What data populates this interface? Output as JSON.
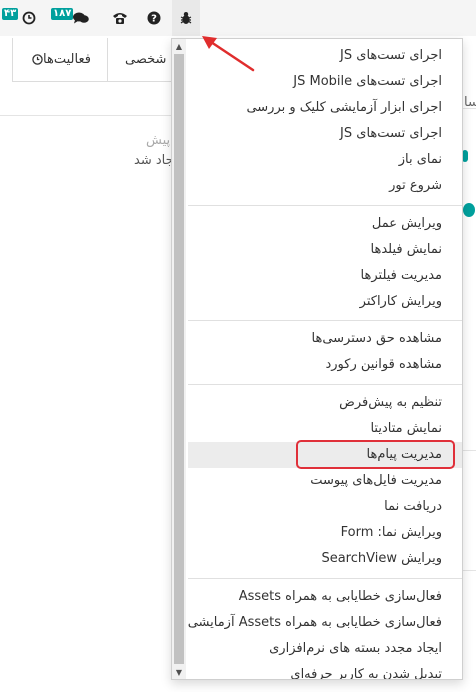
{
  "navbar": {
    "activity_badge": "۴۳",
    "messages_badge": "۱۸۷"
  },
  "tabs": {
    "activities_label": "فعالیت‌ها",
    "personal_label": "شخصی"
  },
  "background": {
    "line1": "ر پیش",
    "line2": "جاد شد",
    "frag1": "مسا"
  },
  "debug_menu": {
    "groups": [
      {
        "items": [
          "اجرای تست‌های JS",
          "اجرای تست‌های JS Mobile",
          "اجرای ابزار آزمایشی کلیک و بررسی",
          "اجرای تست‌های JS",
          "نمای باز",
          "شروع تور"
        ]
      },
      {
        "items": [
          "ویرایش عمل",
          "نمایش فیلدها",
          "مدیریت فیلترها",
          "ویرایش کاراکتر"
        ]
      },
      {
        "items": [
          "مشاهده حق دسترسی‌ها",
          "مشاهده قوانین رکورد"
        ]
      },
      {
        "items": [
          "تنظیم به پیش‌فرض",
          "نمایش متادیتا",
          "مدیریت پیام‌ها",
          "مدیریت فایل‌های پیوست",
          "دریافت نما",
          "ویرایش نما: Form",
          "ویرایش SearchView"
        ]
      },
      {
        "items": [
          "فعال‌سازی خطایابی به همراه Assets",
          "فعال‌سازی خطایابی به همراه Assets آزمایشی",
          "ایجاد مجدد بسته های نرم‌افزاری",
          "تبدیل شدن به کاربر حرفه‌ای"
        ]
      }
    ]
  },
  "colors": {
    "accent": "#00a09d",
    "highlight": "#e0303a"
  }
}
